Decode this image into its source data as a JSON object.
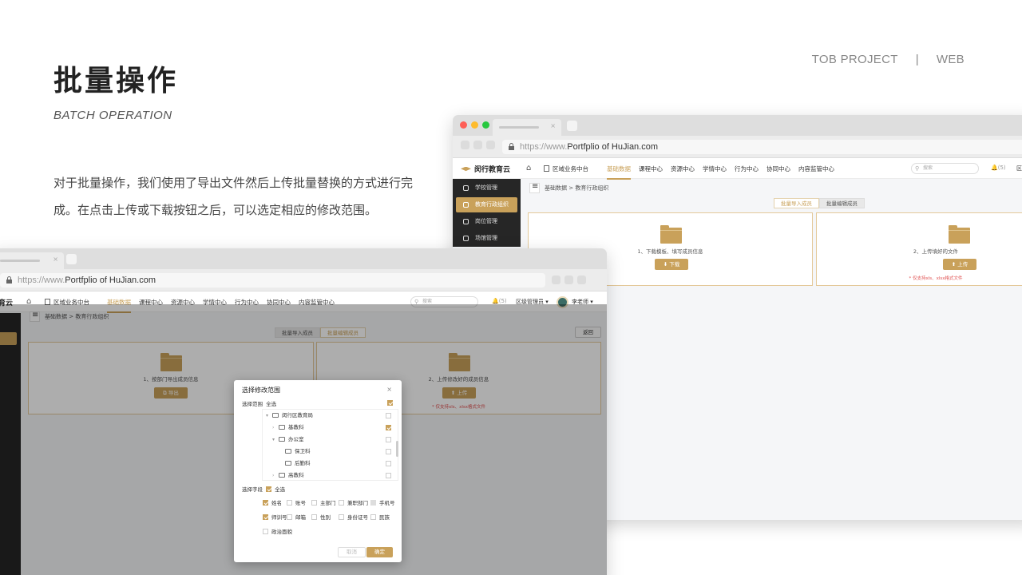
{
  "slide": {
    "header_left": "TOB PROJECT",
    "header_sep": "|",
    "header_right": "WEB",
    "title": "批量操作",
    "subtitle": "BATCH OPERATION",
    "desc": "对于批量操作，我们使用了导出文件然后上传批量替换的方式进行完成。在点击上传或下载按钮之后，可以选定相应的修改范围。"
  },
  "colors": {
    "accent": "#c9a15a",
    "sidebar": "#262626",
    "warning": "#e05050"
  },
  "browser": {
    "url_prefix": "https://www.",
    "url_domain": "Portfplio of HuJian.com",
    "tab_close": "×"
  },
  "app": {
    "logo_text": "闵行教育云",
    "logo_text_cut": "育云",
    "home_icon": "⌂",
    "region": "区域业务中台",
    "menu": [
      "基础数据",
      "课程中心",
      "资源中心",
      "学情中心",
      "行为中心",
      "协同中心",
      "内容监管中心"
    ],
    "search_placeholder": "搜索",
    "bell": "🔔(5)",
    "admin": "区级管理员 ▾",
    "user": "李老师 ▾",
    "user_cut": "区级"
  },
  "back_window": {
    "sidebar": [
      "学校管理",
      "教育行政组织",
      "岗位管理",
      "场馆管理"
    ],
    "breadcrumb": "基础数据  >  教育行政组织",
    "segments": [
      "批量导入成员",
      "批量编辑成员"
    ],
    "card1": {
      "caption": "1、下载模板、填写成员信息",
      "button": "⬇  下载"
    },
    "card2": {
      "caption": "2、上传填好的文件",
      "button": "⬆  上传",
      "note": "* 仅支持xls、xlsx格式文件"
    }
  },
  "front_window": {
    "breadcrumb": "基础数据  >  教育行政组织",
    "segments": [
      "批量导入成员",
      "批量编辑成员"
    ],
    "return_button": "返回",
    "card1": {
      "caption": "1、按部门导出成员信息",
      "button": "⧉  导出"
    },
    "card2": {
      "caption": "2、上传修改好的成员信息",
      "button": "⬆  上传",
      "note": "* 仅支持xls、xlsx格式文件"
    }
  },
  "modal": {
    "title": "选择修改范围",
    "close": "×",
    "scope_label": "选择范围",
    "scope_all": "全选",
    "tree": [
      {
        "label": "闵行区教育局",
        "indent": 0,
        "arrow": "▾",
        "checked": false
      },
      {
        "label": "基教科",
        "indent": 1,
        "arrow": "›",
        "checked": true
      },
      {
        "label": "办公室",
        "indent": 1,
        "arrow": "▾",
        "checked": false
      },
      {
        "label": "保卫科",
        "indent": 2,
        "arrow": "",
        "checked": false
      },
      {
        "label": "后勤科",
        "indent": 2,
        "arrow": "",
        "checked": false
      },
      {
        "label": "高教科",
        "indent": 1,
        "arrow": "›",
        "checked": false
      }
    ],
    "fields_label": "选择字段",
    "fields_all": "全选",
    "fields": [
      {
        "label": "姓名",
        "state": "on"
      },
      {
        "label": "账号",
        "state": "off"
      },
      {
        "label": "主部门",
        "state": "off"
      },
      {
        "label": "兼职部门",
        "state": "off"
      },
      {
        "label": "手机号",
        "state": "dis"
      },
      {
        "label": "师训号",
        "state": "on"
      },
      {
        "label": "邮箱",
        "state": "off"
      },
      {
        "label": "性别",
        "state": "off"
      },
      {
        "label": "身份证号",
        "state": "off"
      },
      {
        "label": "民族",
        "state": "off"
      },
      {
        "label": "政治面貌",
        "state": "off"
      }
    ],
    "cancel": "取消",
    "ok": "确定"
  }
}
